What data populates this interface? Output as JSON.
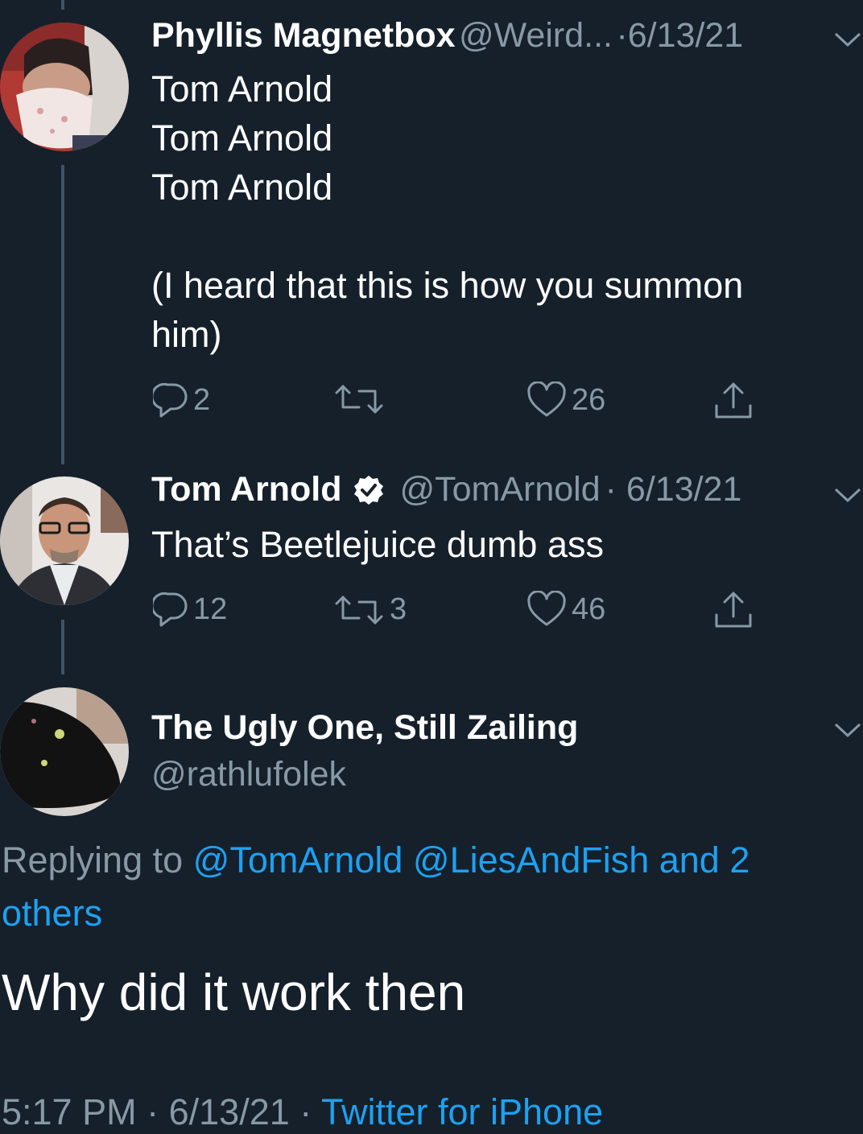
{
  "tweets": [
    {
      "name": "Phyllis Magnetbox",
      "handle": "@Weird...",
      "date": "·6/13/21",
      "lines": [
        "Tom Arnold",
        "Tom Arnold",
        "Tom Arnold",
        "",
        "(I heard that this is how you summon",
        "him)"
      ],
      "replies": "2",
      "retweets": "",
      "likes": "26"
    },
    {
      "name": "Tom Arnold",
      "handle": "@TomArnold",
      "date": "· 6/13/21",
      "verified": true,
      "text": "That’s Beetlejuice dumb ass",
      "replies": "12",
      "retweets": "3",
      "likes": "46"
    }
  ],
  "focused": {
    "name": "The Ugly One, Still Zailing",
    "handle": "@rathlufolek",
    "replying_prefix": "Replying to",
    "replying_to": "@TomArnold @LiesAndFish and 2",
    "replying_to_2": "others",
    "text": "Why did it work then",
    "time": "5:17 PM",
    "sep1": "·",
    "date": "6/13/21",
    "sep2": "·",
    "source": "Twitter for iPhone"
  },
  "colors": {
    "background": "#15202b",
    "secondary_text": "#8899a6",
    "link": "#1da1f2",
    "thread_line": "#3d5466"
  },
  "icons": [
    "reply-icon",
    "retweet-icon",
    "like-icon",
    "share-icon",
    "chevron-down-icon",
    "verified-badge-icon"
  ]
}
